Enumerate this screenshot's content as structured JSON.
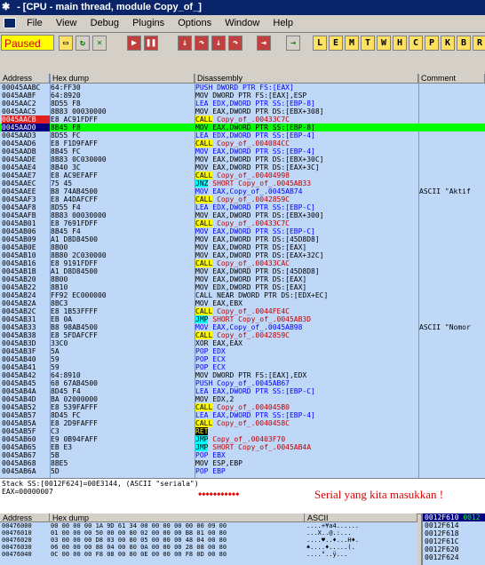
{
  "window": {
    "title": "- [CPU - main thread, module Copy_of_]"
  },
  "menu": [
    "File",
    "View",
    "Debug",
    "Plugins",
    "Options",
    "Window",
    "Help"
  ],
  "toolbar": {
    "status": "Paused",
    "buttons": [
      "open",
      "restart",
      "close",
      "run",
      "pause",
      "step-into",
      "step-over",
      "trace-into",
      "trace-over",
      "execute-till-return",
      "go-to",
      "L",
      "E",
      "M",
      "T",
      "W",
      "H",
      "C",
      "P",
      "K",
      "B"
    ]
  },
  "columns": {
    "address": "Address",
    "hex": "Hex dump",
    "disasm": "Disassembly",
    "comment": "Comment"
  },
  "colors": {
    "pane_bg": "#c0d8f8",
    "current_line": "#00ff00",
    "breakpoint": "#e02020",
    "call": "#ffff00",
    "jump": "#00ffff",
    "push_pop": "#0000ff",
    "mem_ref": "#0000ff"
  },
  "disasm": [
    {
      "a": "00045AABC",
      "h": "64:FF30",
      "d": "PUSH DWORD PTR FS:[EAX]",
      "t": "pp"
    },
    {
      "a": "0045AABF",
      "h": "64:8920",
      "d": "MOV DWORD PTR FS:[EAX],ESP",
      "t": ""
    },
    {
      "a": "0045AAC2",
      "h": "8D55 F8",
      "d": "LEA EDX,DWORD PTR SS:[EBP-8]",
      "t": "m"
    },
    {
      "a": "0045AAC5",
      "h": "8B83 00030000",
      "d": "MOV EAX,DWORD PTR DS:[EBX+308]",
      "t": ""
    },
    {
      "a": "0045AACB",
      "h": "E8 AC91FDFF",
      "d": "CALL Copy_of_.00433C7C",
      "t": "c",
      "bp": true
    },
    {
      "a": "0045AAD0",
      "h": "8B45 F8",
      "d": "MOV EAX,DWORD PTR SS:[EBP-8]",
      "t": "m",
      "cur": true
    },
    {
      "a": "0045AAD3",
      "h": "8D55 FC",
      "d": "LEA EDX,DWORD PTR SS:[EBP-4]",
      "t": "m"
    },
    {
      "a": "0045AAD6",
      "h": "E8 F1D9FAFF",
      "d": "CALL Copy_of_.004084CC",
      "t": "c"
    },
    {
      "a": "0045AADB",
      "h": "8B45 FC",
      "d": "MOV EAX,DWORD PTR SS:[EBP-4]",
      "t": "m"
    },
    {
      "a": "0045AADE",
      "h": "8B83 0C030000",
      "d": "MOV EAX,DWORD PTR DS:[EBX+30C]",
      "t": ""
    },
    {
      "a": "0045AAE4",
      "h": "8B40 3C",
      "d": "MOV EAX,DWORD PTR DS:[EAX+3C]",
      "t": ""
    },
    {
      "a": "0045AAE7",
      "h": "E8 AC9EFAFF",
      "d": "CALL Copy_of_.00404998",
      "t": "c"
    },
    {
      "a": "0045AAEC",
      "h": "75 45",
      "d": "JNZ SHORT Copy_of_.0045AB33",
      "t": "j"
    },
    {
      "a": "0045AAEE",
      "h": "B8 74AB4500",
      "d": "MOV EAX,Copy_of_.0045AB74",
      "t": "m"
    },
    {
      "a": "0045AAF3",
      "h": "E8 A4DAFCFF",
      "d": "CALL Copy_of_.0042859C",
      "t": "c"
    },
    {
      "a": "0045AAF8",
      "h": "8D55 F4",
      "d": "LEA EDX,DWORD PTR SS:[EBP-C]",
      "t": "m"
    },
    {
      "a": "0045AAFB",
      "h": "8B83 00030000",
      "d": "MOV EAX,DWORD PTR DS:[EBX+300]",
      "t": ""
    },
    {
      "a": "0045AB01",
      "h": "E8 7691FDFF",
      "d": "CALL Copy_of_.00433C7C",
      "t": "c"
    },
    {
      "a": "0045AB06",
      "h": "8B45 F4",
      "d": "MOV EAX,DWORD PTR SS:[EBP-C]",
      "t": "m"
    },
    {
      "a": "0045AB09",
      "h": "A1 D8D84500",
      "d": "MOV EAX,DWORD PTR DS:[45D8D8]",
      "t": ""
    },
    {
      "a": "0045AB0E",
      "h": "8B00",
      "d": "MOV EAX,DWORD PTR DS:[EAX]",
      "t": ""
    },
    {
      "a": "0045AB10",
      "h": "8B80 2C030000",
      "d": "MOV EAX,DWORD PTR DS:[EAX+32C]",
      "t": ""
    },
    {
      "a": "0045AB16",
      "h": "E8 9191FDFF",
      "d": "CALL Copy_of_.00433CAC",
      "t": "c"
    },
    {
      "a": "0045AB1B",
      "h": "A1 D8D84500",
      "d": "MOV EAX,DWORD PTR DS:[45D8D8]",
      "t": ""
    },
    {
      "a": "0045AB20",
      "h": "8B00",
      "d": "MOV EAX,DWORD PTR DS:[EAX]",
      "t": ""
    },
    {
      "a": "0045AB22",
      "h": "8B10",
      "d": "MOV EDX,DWORD PTR DS:[EAX]",
      "t": ""
    },
    {
      "a": "0045AB24",
      "h": "FF92 EC000000",
      "d": "CALL NEAR DWORD PTR DS:[EDX+EC]",
      "t": ""
    },
    {
      "a": "0045AB2A",
      "h": "8BC3",
      "d": "MOV EAX,EBX",
      "t": ""
    },
    {
      "a": "0045AB2C",
      "h": "E8 1B53FFFF",
      "d": "CALL Copy_of_.0044FE4C",
      "t": "c"
    },
    {
      "a": "0045AB31",
      "h": "EB 0A",
      "d": "JMP SHORT Copy_of_.0045AB3D",
      "t": "j"
    },
    {
      "a": "0045AB33",
      "h": "B8 98AB4500",
      "d": "MOV EAX,Copy_of_.0045AB98",
      "t": "m"
    },
    {
      "a": "0045AB38",
      "h": "E8 5FDAFCFF",
      "d": "CALL Copy_of_.0042859C",
      "t": "c"
    },
    {
      "a": "0045AB3D",
      "h": "33C0",
      "d": "XOR EAX,EAX",
      "t": ""
    },
    {
      "a": "0045AB3F",
      "h": "5A",
      "d": "POP EDX",
      "t": "pp"
    },
    {
      "a": "0045AB40",
      "h": "59",
      "d": "POP ECX",
      "t": "pp"
    },
    {
      "a": "0045AB41",
      "h": "59",
      "d": "POP ECX",
      "t": "pp"
    },
    {
      "a": "0045AB42",
      "h": "64:8910",
      "d": "MOV DWORD PTR FS:[EAX],EDX",
      "t": ""
    },
    {
      "a": "0045AB45",
      "h": "68 67AB4500",
      "d": "PUSH Copy_of_.0045AB67",
      "t": "pp"
    },
    {
      "a": "0045AB4A",
      "h": "8D45 F4",
      "d": "LEA EAX,DWORD PTR SS:[EBP-C]",
      "t": "m"
    },
    {
      "a": "0045AB4D",
      "h": "BA 02000000",
      "d": "MOV EDX,2",
      "t": ""
    },
    {
      "a": "0045AB52",
      "h": "E8 539FAFFF",
      "d": "CALL Copy_of_.004045B0",
      "t": "c"
    },
    {
      "a": "0045AB57",
      "h": "8D45 FC",
      "d": "LEA EAX,DWORD PTR SS:[EBP-4]",
      "t": "m"
    },
    {
      "a": "0045AB5A",
      "h": "E8 2D9FAFFF",
      "d": "CALL Copy_of_.0040458C",
      "t": "c"
    },
    {
      "a": "0045AB5F",
      "h": "C3",
      "d": "RET",
      "t": "r"
    },
    {
      "a": "0045AB60",
      "h": "E9 0B94FAFF",
      "d": "JMP Copy_of_.00403F70",
      "t": "j"
    },
    {
      "a": "0045AB65",
      "h": "EB E3",
      "d": "JMP SHORT Copy_of_.0045AB4A",
      "t": "j"
    },
    {
      "a": "0045AB67",
      "h": "5B",
      "d": "POP EBX",
      "t": "pp"
    },
    {
      "a": "0045AB68",
      "h": "8BE5",
      "d": "MOV ESP,EBP",
      "t": ""
    },
    {
      "a": "0045AB6A",
      "h": "5D",
      "d": "POP EBP",
      "t": "pp"
    }
  ],
  "comments": [
    {
      "row": 13,
      "text": "ASCII \"Aktif"
    },
    {
      "row": 30,
      "text": "ASCII \"Nomor"
    }
  ],
  "info": {
    "line1": "Stack SS:[0012F624]=00E3144, (ASCII \"seriala\")",
    "line2": "EAX=00000007",
    "mark": "◆◆◆◆◆◆◆◆◆◆◆",
    "annotation": "Serial yang kita masukkan !"
  },
  "dump_columns": {
    "address": "Address",
    "hex": "Hex dump",
    "ascii": "ASCII"
  },
  "dump": [
    {
      "a": "00476000",
      "h": "00 00 00 00 1A 9D 61 34 00 00 00 00 00 00 09 00",
      "s": "....+¥a4......"
    },
    {
      "a": "00476010",
      "h": "01 00 00 00 50 00 00 80 02 00 00 00 B8 01 00 80",
      "s": "...X..@.:..."
    },
    {
      "a": "00476020",
      "h": "03 00 00 00 D8 03 00 80 05 00 00 00 48 04 00 80",
      "s": "....♥..♦...H♦."
    },
    {
      "a": "00476030",
      "h": "06 00 00 00 88 04 00 80 0A 00 00 00 28 08 00 80",
      "s": "♠....♦.....(."
    },
    {
      "a": "00476040",
      "h": "0C 00 00 00 F8 08 00 80 0E 00 00 00 F8 0D 00 80",
      "s": "....°..ÿ..."
    }
  ],
  "stack": [
    {
      "a": "0012F610",
      "v": "0012"
    },
    {
      "a": "0012F614",
      "v": ""
    },
    {
      "a": "0012F618",
      "v": ""
    },
    {
      "a": "0012F61C",
      "v": ""
    },
    {
      "a": "0012F620",
      "v": ""
    },
    {
      "a": "0012F624",
      "v": ""
    }
  ]
}
